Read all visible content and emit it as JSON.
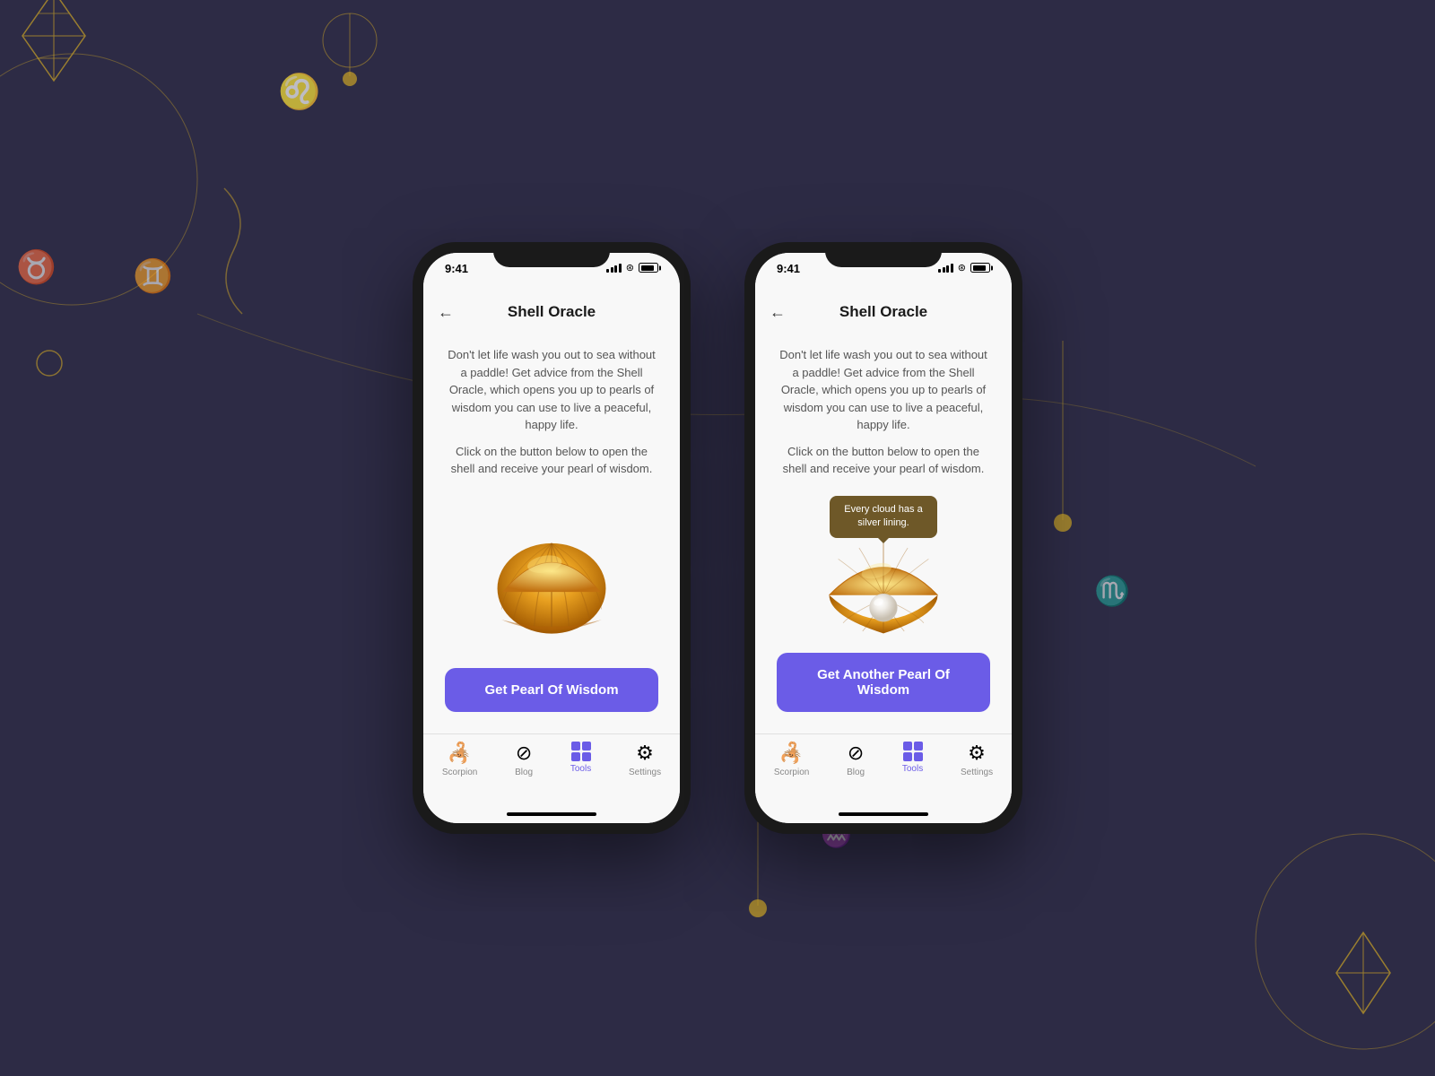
{
  "background": {
    "color": "#2d2b45"
  },
  "phones": [
    {
      "id": "phone-left",
      "status_time": "9:41",
      "nav_back": "←",
      "nav_title": "Shell Oracle",
      "description": "Don't let life wash you out to sea without a paddle! Get advice from the Shell Oracle, which opens you up to pearls of wisdom you can use to live a peaceful, happy life.",
      "instruction": "Click on the button below to open the shell and receive your pearl of wisdom.",
      "shell_state": "closed",
      "wisdom_text": null,
      "button_label": "Get Pearl Of Wisdom",
      "tabs": [
        {
          "label": "Scorpion",
          "icon": "scorpion",
          "active": false
        },
        {
          "label": "Blog",
          "icon": "blog",
          "active": false
        },
        {
          "label": "Tools",
          "icon": "tools",
          "active": true
        },
        {
          "label": "Settings",
          "icon": "settings",
          "active": false
        }
      ]
    },
    {
      "id": "phone-right",
      "status_time": "9:41",
      "nav_back": "←",
      "nav_title": "Shell Oracle",
      "description": "Don't let life wash you out to sea without a paddle! Get advice from the Shell Oracle, which opens you up to pearls of wisdom you can use to live a peaceful, happy life.",
      "instruction": "Click on the button below to open the shell and receive your pearl of wisdom.",
      "shell_state": "open",
      "wisdom_text": "Every cloud has a silver lining.",
      "button_label": "Get Another Pearl Of Wisdom",
      "tabs": [
        {
          "label": "Scorpion",
          "icon": "scorpion",
          "active": false
        },
        {
          "label": "Blog",
          "icon": "blog",
          "active": false
        },
        {
          "label": "Tools",
          "icon": "tools",
          "active": true
        },
        {
          "label": "Settings",
          "icon": "settings",
          "active": false
        }
      ]
    }
  ]
}
